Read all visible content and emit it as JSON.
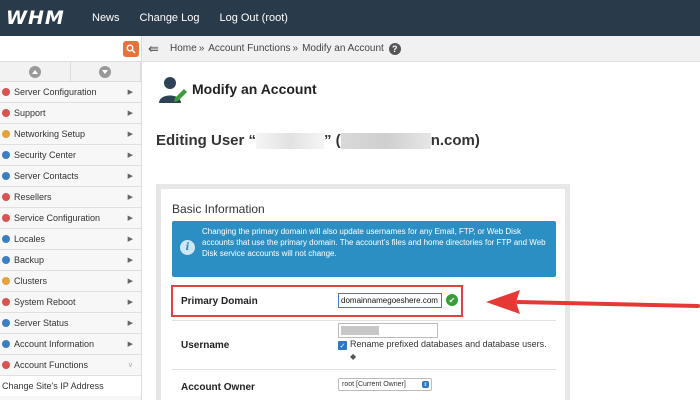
{
  "topbar": {
    "logo": "WHM",
    "nav": [
      "News",
      "Change Log",
      "Log Out (root)"
    ]
  },
  "sidebar": {
    "search_placeholder": "",
    "items": [
      {
        "label": "Server Configuration",
        "color": "#d9534f"
      },
      {
        "label": "Support",
        "color": "#d9534f"
      },
      {
        "label": "Networking Setup",
        "color": "#e5a13a"
      },
      {
        "label": "Security Center",
        "color": "#3a7fc1"
      },
      {
        "label": "Server Contacts",
        "color": "#3a7fc1"
      },
      {
        "label": "Resellers",
        "color": "#d9534f"
      },
      {
        "label": "Service Configuration",
        "color": "#d9534f"
      },
      {
        "label": "Locales",
        "color": "#3a7fc1"
      },
      {
        "label": "Backup",
        "color": "#3a7fc1"
      },
      {
        "label": "Clusters",
        "color": "#e5a13a"
      },
      {
        "label": "System Reboot",
        "color": "#d9534f"
      },
      {
        "label": "Server Status",
        "color": "#3a7fc1"
      },
      {
        "label": "Account Information",
        "color": "#3a7fc1"
      },
      {
        "label": "Account Functions",
        "color": "#d9534f"
      }
    ],
    "sub_item": "Change Site's IP Address"
  },
  "breadcrumb": {
    "home": "Home",
    "section": "Account Functions",
    "page": "Modify an Account"
  },
  "page": {
    "title": "Modify an Account",
    "editing_prefix": "Editing User “",
    "editing_middle": "” (",
    "editing_suffix": "n.com)"
  },
  "panel": {
    "title": "Basic Information",
    "info": "Changing the primary domain will also update usernames for any Email, FTP, or Web Disk accounts that use the primary domain. The account’s files and home directories for FTP and Web Disk service accounts will not change.",
    "primary_domain_label": "Primary Domain",
    "primary_domain_value": "domainnamegoeshere.com",
    "username_label": "Username",
    "prefix_label": "Rename prefixed databases and database users.",
    "owner_label": "Account Owner",
    "owner_value": "root [Current Owner]"
  },
  "colors": {
    "topbar": "#293a4a",
    "info_box": "#2b8fc4",
    "highlight": "#e54040",
    "accent": "#e8733a"
  }
}
